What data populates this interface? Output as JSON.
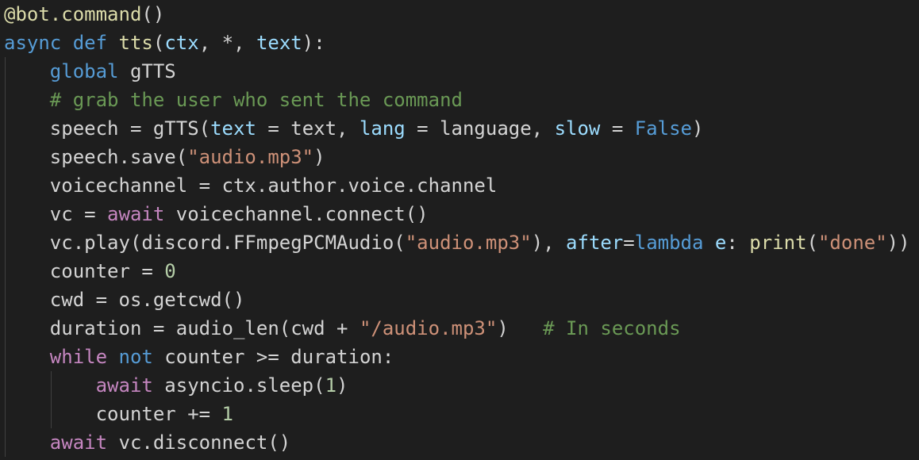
{
  "editor": {
    "theme_colors": {
      "background": "#1e1e1e",
      "default": "#d4d4d4",
      "keyword_blue": "#569cd6",
      "keyword_control": "#c586c0",
      "function": "#dcdcaa",
      "variable": "#9cdcfe",
      "string": "#ce9178",
      "comment": "#6a9955",
      "number": "#b5cea8",
      "indent_guide": "#404040"
    },
    "lines": [
      {
        "indent": 0,
        "guides": 0,
        "tokens": [
          {
            "t": "@bot.command",
            "c": "function"
          },
          {
            "t": "()",
            "c": "default"
          }
        ]
      },
      {
        "indent": 0,
        "guides": 0,
        "tokens": [
          {
            "t": "async",
            "c": "keyword_blue"
          },
          {
            "t": " ",
            "c": "default"
          },
          {
            "t": "def",
            "c": "keyword_blue"
          },
          {
            "t": " ",
            "c": "default"
          },
          {
            "t": "tts",
            "c": "function"
          },
          {
            "t": "(",
            "c": "default"
          },
          {
            "t": "ctx",
            "c": "variable"
          },
          {
            "t": ", ",
            "c": "default"
          },
          {
            "t": "*",
            "c": "default"
          },
          {
            "t": ", ",
            "c": "default"
          },
          {
            "t": "text",
            "c": "variable"
          },
          {
            "t": "):",
            "c": "default"
          }
        ]
      },
      {
        "indent": 4,
        "guides": 1,
        "tokens": [
          {
            "t": "global",
            "c": "keyword_blue"
          },
          {
            "t": " gTTS",
            "c": "default"
          }
        ]
      },
      {
        "indent": 4,
        "guides": 1,
        "tokens": [
          {
            "t": "# grab the user who sent the command",
            "c": "comment"
          }
        ]
      },
      {
        "indent": 4,
        "guides": 1,
        "tokens": [
          {
            "t": "speech = gTTS(",
            "c": "default"
          },
          {
            "t": "text",
            "c": "variable"
          },
          {
            "t": " = text, ",
            "c": "default"
          },
          {
            "t": "lang",
            "c": "variable"
          },
          {
            "t": " = language, ",
            "c": "default"
          },
          {
            "t": "slow",
            "c": "variable"
          },
          {
            "t": " = ",
            "c": "default"
          },
          {
            "t": "False",
            "c": "keyword_blue"
          },
          {
            "t": ")",
            "c": "default"
          }
        ]
      },
      {
        "indent": 4,
        "guides": 1,
        "tokens": [
          {
            "t": "speech.save(",
            "c": "default"
          },
          {
            "t": "\"audio.mp3\"",
            "c": "string"
          },
          {
            "t": ")",
            "c": "default"
          }
        ]
      },
      {
        "indent": 4,
        "guides": 1,
        "tokens": [
          {
            "t": "voicechannel = ctx.author.voice.channel",
            "c": "default"
          }
        ]
      },
      {
        "indent": 4,
        "guides": 1,
        "tokens": [
          {
            "t": "vc = ",
            "c": "default"
          },
          {
            "t": "await",
            "c": "keyword_control"
          },
          {
            "t": " voicechannel.connect()",
            "c": "default"
          }
        ]
      },
      {
        "indent": 4,
        "guides": 1,
        "tokens": [
          {
            "t": "vc.play(discord.FFmpegPCMAudio(",
            "c": "default"
          },
          {
            "t": "\"audio.mp3\"",
            "c": "string"
          },
          {
            "t": "), ",
            "c": "default"
          },
          {
            "t": "after",
            "c": "variable"
          },
          {
            "t": "=",
            "c": "default"
          },
          {
            "t": "lambda",
            "c": "keyword_blue"
          },
          {
            "t": " ",
            "c": "default"
          },
          {
            "t": "e",
            "c": "variable"
          },
          {
            "t": ": ",
            "c": "default"
          },
          {
            "t": "print",
            "c": "function"
          },
          {
            "t": "(",
            "c": "default"
          },
          {
            "t": "\"done\"",
            "c": "string"
          },
          {
            "t": "))",
            "c": "default"
          }
        ]
      },
      {
        "indent": 4,
        "guides": 1,
        "tokens": [
          {
            "t": "counter = ",
            "c": "default"
          },
          {
            "t": "0",
            "c": "number"
          }
        ]
      },
      {
        "indent": 4,
        "guides": 1,
        "tokens": [
          {
            "t": "cwd = os.getcwd()",
            "c": "default"
          }
        ]
      },
      {
        "indent": 4,
        "guides": 1,
        "tokens": [
          {
            "t": "duration = audio_len(cwd + ",
            "c": "default"
          },
          {
            "t": "\"/audio.mp3\"",
            "c": "string"
          },
          {
            "t": ")   ",
            "c": "default"
          },
          {
            "t": "# In seconds",
            "c": "comment"
          }
        ]
      },
      {
        "indent": 4,
        "guides": 1,
        "tokens": [
          {
            "t": "while",
            "c": "keyword_control"
          },
          {
            "t": " ",
            "c": "default"
          },
          {
            "t": "not",
            "c": "keyword_blue"
          },
          {
            "t": " counter >= duration:",
            "c": "default"
          }
        ]
      },
      {
        "indent": 8,
        "guides": 2,
        "tokens": [
          {
            "t": "await",
            "c": "keyword_control"
          },
          {
            "t": " asyncio.sleep(",
            "c": "default"
          },
          {
            "t": "1",
            "c": "number"
          },
          {
            "t": ")",
            "c": "default"
          }
        ]
      },
      {
        "indent": 8,
        "guides": 2,
        "tokens": [
          {
            "t": "counter += ",
            "c": "default"
          },
          {
            "t": "1",
            "c": "number"
          }
        ]
      },
      {
        "indent": 4,
        "guides": 1,
        "tokens": [
          {
            "t": "await",
            "c": "keyword_control"
          },
          {
            "t": " vc.disconnect()",
            "c": "default"
          }
        ]
      }
    ]
  }
}
